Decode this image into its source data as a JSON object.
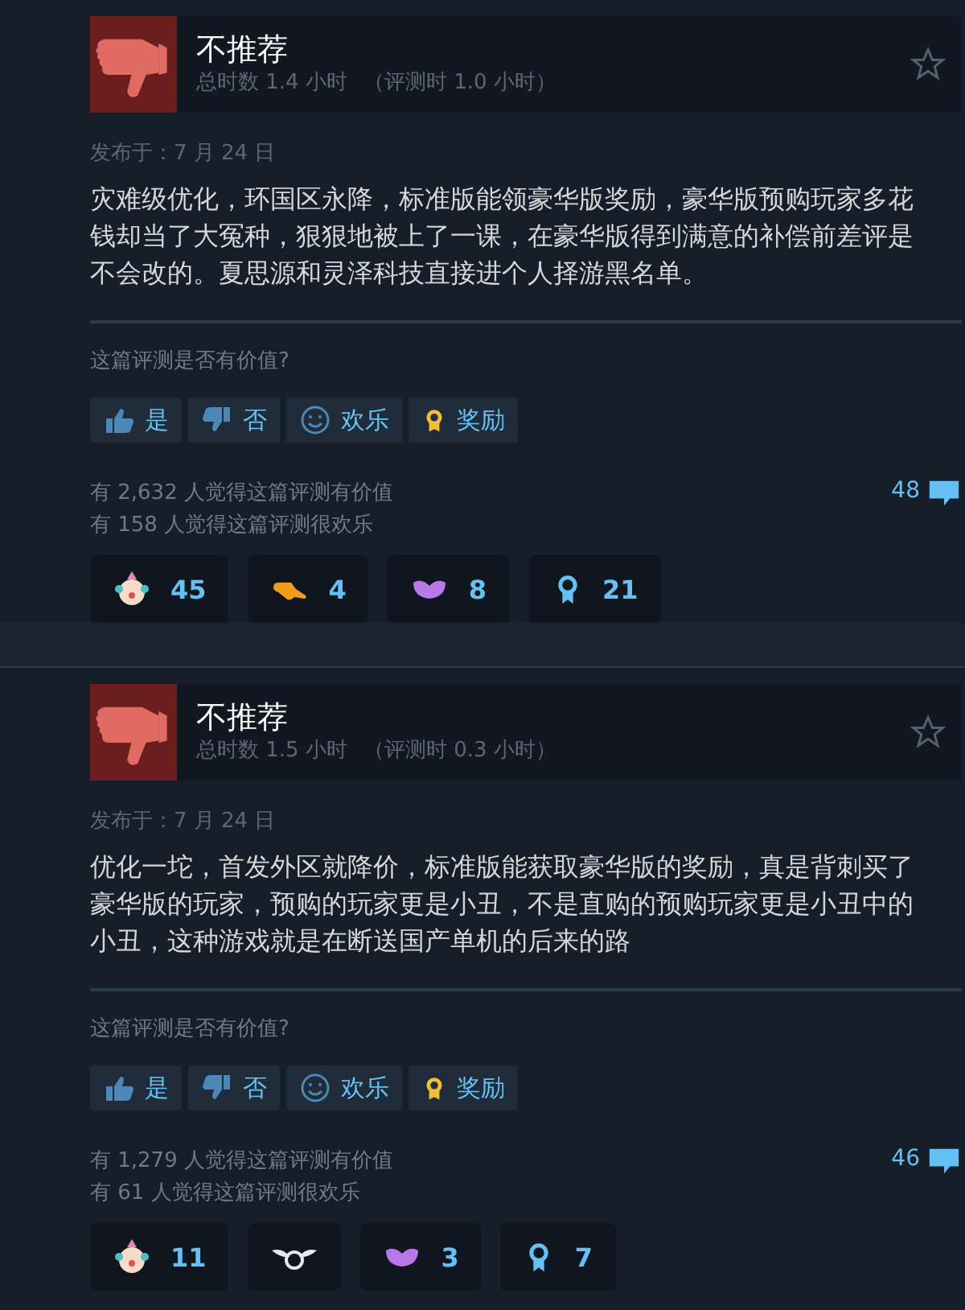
{
  "reviews": [
    {
      "verdict": "不推荐",
      "recommended": false,
      "playtime": "总时数 1.4 小时",
      "review_time": "（评测时 1.0 小时）",
      "posted": "发布于：7 月 24 日",
      "text": "灾难级优化，环国区永降，标准版能领豪华版奖励，豪华版预购玩家多花钱却当了大冤种，狠狠地被上了一课，在豪华版得到满意的补偿前差评是不会改的。夏思源和灵泽科技直接进个人择游黑名单。",
      "question": "这篇评测是否有价值?",
      "buttons": [
        {
          "kind": "yes",
          "label": "是"
        },
        {
          "kind": "no",
          "label": "否"
        },
        {
          "kind": "funny",
          "label": "欢乐"
        },
        {
          "kind": "award",
          "label": "奖励"
        }
      ],
      "helpful": "有 2,632 人觉得这篇评测有价值",
      "funny": "有 158 人觉得这篇评测很欢乐",
      "comments": "48",
      "awards": [
        {
          "kind": "clown",
          "count": "45"
        },
        {
          "kind": "hand",
          "count": "4"
        },
        {
          "kind": "lips",
          "count": "8"
        },
        {
          "kind": "medal",
          "count": "21"
        }
      ]
    },
    {
      "verdict": "不推荐",
      "recommended": false,
      "playtime": "总时数 1.5 小时",
      "review_time": "（评测时 0.3 小时）",
      "posted": "发布于：7 月 24 日",
      "text": "优化一坨，首发外区就降价，标准版能获取豪华版的奖励，真是背刺买了豪华版的玩家，预购的玩家更是小丑，不是直购的预购玩家更是小丑中的小丑，这种游戏就是在断送国产单机的后来的路",
      "question": "这篇评测是否有价值?",
      "buttons": [
        {
          "kind": "yes",
          "label": "是"
        },
        {
          "kind": "no",
          "label": "否"
        },
        {
          "kind": "funny",
          "label": "欢乐"
        },
        {
          "kind": "award",
          "label": "奖励"
        }
      ],
      "helpful": "有 1,279 人觉得这篇评测有价值",
      "funny": "有 61 人觉得这篇评测很欢乐",
      "comments": "46",
      "awards": [
        {
          "kind": "clown",
          "count": "11"
        },
        {
          "kind": "wings"
        },
        {
          "kind": "lips",
          "count": "3"
        },
        {
          "kind": "medal",
          "count": "7"
        }
      ]
    }
  ]
}
